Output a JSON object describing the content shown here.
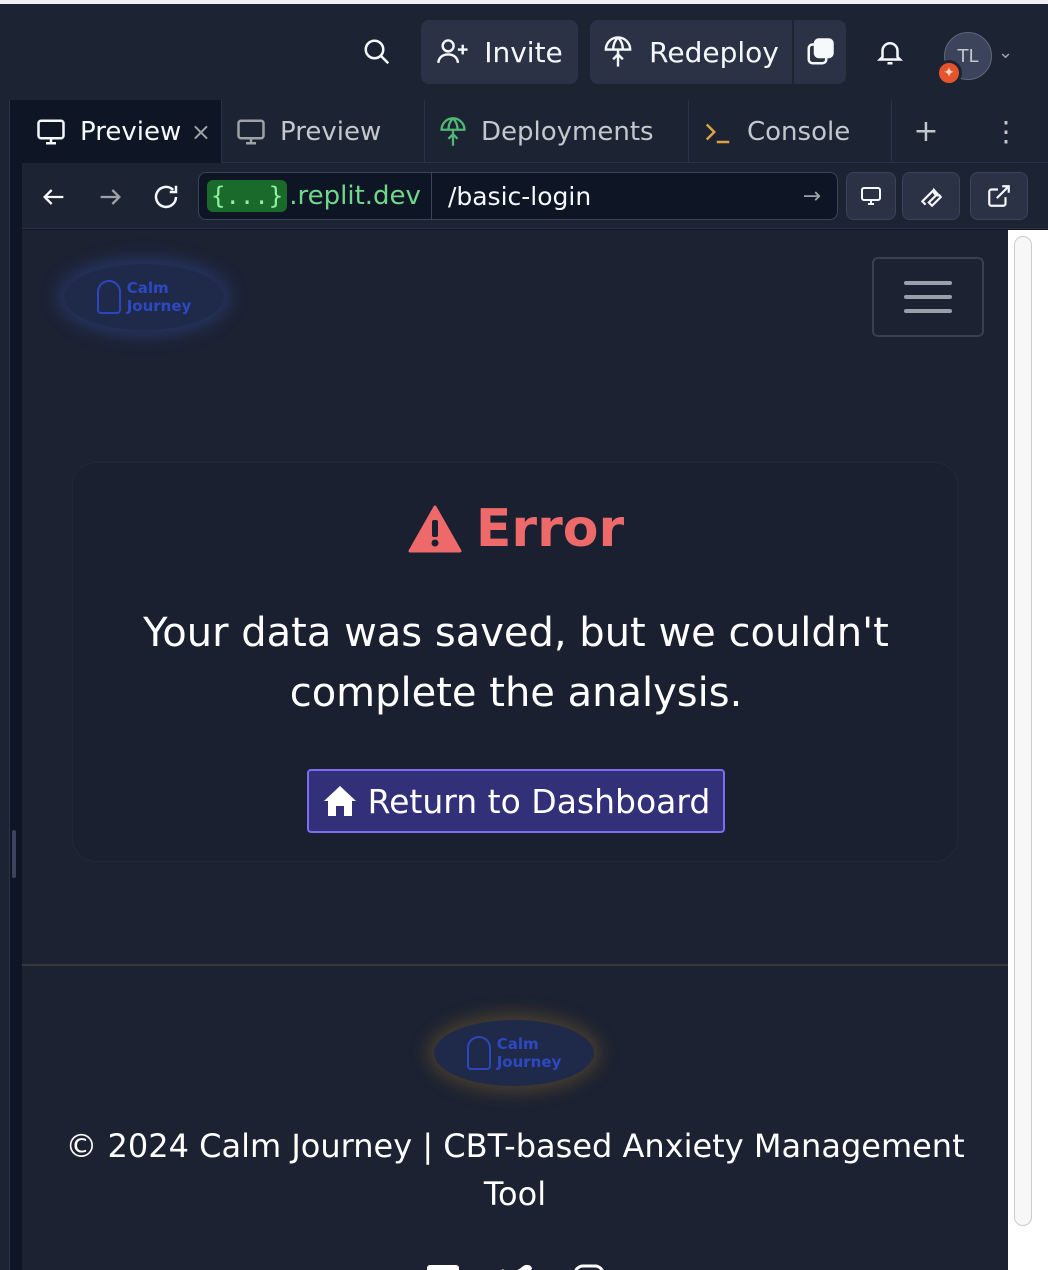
{
  "topbar": {
    "invite_label": "Invite",
    "redeploy_label": "Redeploy",
    "avatar_initials": "TL"
  },
  "tabs": [
    {
      "label": "Preview",
      "icon": "monitor-icon",
      "active": true
    },
    {
      "label": "Preview",
      "icon": "monitor-icon",
      "active": false
    },
    {
      "label": "Deployments",
      "icon": "deploy-icon",
      "active": false
    },
    {
      "label": "Console",
      "icon": "terminal-icon",
      "active": false
    }
  ],
  "address": {
    "brace": "{...}",
    "domain": ".replit.dev",
    "path": "/basic-login"
  },
  "page": {
    "logo_text_line1": "Calm",
    "logo_text_line2": "Journey",
    "error_title": "Error",
    "error_message": "Your data was saved, but we couldn't complete the analysis.",
    "return_button": "Return to Dashboard",
    "footer_text": "© 2024 Calm Journey | CBT-based Anxiety Management Tool"
  },
  "colors": {
    "error": "#ee6a6a",
    "button_bg": "#33307a",
    "button_border": "#7c6cf0",
    "domain_green": "#6fd88a"
  }
}
